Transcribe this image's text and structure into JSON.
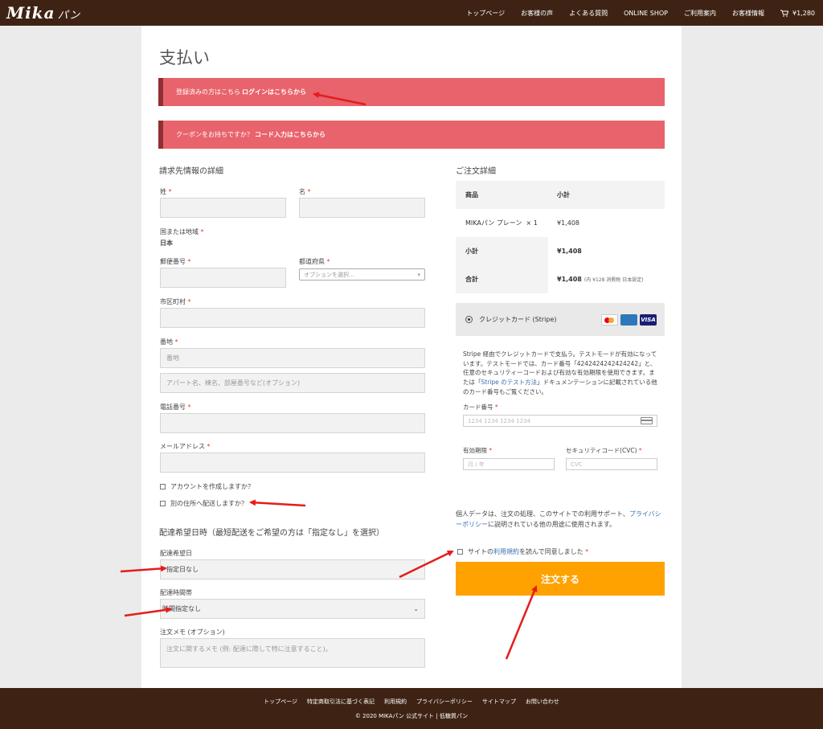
{
  "header": {
    "logo_main": "Mika",
    "logo_sub": "パン",
    "nav": [
      "トップページ",
      "お客様の声",
      "よくある質問",
      "ONLINE SHOP",
      "ご利用案内",
      "お客様情報"
    ],
    "cart_total": "¥1,280"
  },
  "page_title": "支払い",
  "notices": {
    "login_text": "登録済みの方はこちら",
    "login_link": "ログインはこちらから",
    "coupon_text": "クーポンをお持ちですか？",
    "coupon_link": "コード入力はこちらから"
  },
  "billing": {
    "heading": "請求先情報の詳細",
    "last_name": "姓",
    "first_name": "名",
    "country_label": "国または地域",
    "country_value": "日本",
    "postcode": "郵便番号",
    "prefecture": "都道府県",
    "prefecture_placeholder": "オプションを選択...",
    "city": "市区町村",
    "address": "番地",
    "address_placeholder": "番地",
    "address2_placeholder": "アパート名、棟名、部屋番号など(オプション)",
    "phone": "電話番号",
    "email": "メールアドレス",
    "create_account": "アカウントを作成しますか？",
    "ship_different": "別の住所へ配送しますか？"
  },
  "delivery": {
    "heading": "配達希望日時（最短配送をご希望の方は「指定なし」を選択）",
    "date_label": "配達希望日",
    "date_value": "指定日なし",
    "time_label": "配達時間帯",
    "time_value": "時間指定なし",
    "memo_label": "注文メモ (オプション)",
    "memo_placeholder": "注文に関するメモ (例: 配達に際して特に注意すること)。"
  },
  "order": {
    "heading": "ご注文詳細",
    "col_product": "商品",
    "col_subtotal": "小計",
    "item_name": "MIKAパン プレーン",
    "item_qty": "× 1",
    "item_price": "¥1,408",
    "subtotal_label": "小計",
    "subtotal_value": "¥1,408",
    "total_label": "合計",
    "total_value": "¥1,408",
    "total_tax": "(内 ¥128 消費税 日本設定)"
  },
  "payment": {
    "method": "クレジットカード (Stripe)",
    "desc_1": "Stripe 経由でクレジットカードで支払う。テストモードが有効になっています。テストモードでは、カード番号「4242424242424242」と、任意のセキュリティーコードおよび有効な有効期限を使用できます。または「",
    "desc_link": "Stripe のテスト方法",
    "desc_2": "」ドキュメンテーションに記載されている他のカード番号もご覧ください。",
    "card_number_label": "カード番号",
    "card_number_placeholder": "1234 1234 1234 1234",
    "expiry_label": "有効期限",
    "expiry_placeholder": "月 / 年",
    "cvc_label": "セキュリティコード(CVC)",
    "cvc_placeholder": "CVC",
    "visa": "VISA"
  },
  "privacy": {
    "text_1": "個人データは、注文の処理、このサイトでの利用サポート、",
    "link": "プライバシーポリシー",
    "text_2": "に説明されている他の用途に使用されます。"
  },
  "terms": {
    "text_1": "サイトの",
    "link": "利用規約",
    "text_2": "を読んで同意しました"
  },
  "place_order": "注文する",
  "footer": {
    "links": [
      "トップページ",
      "特定商取引法に基づく表記",
      "利用規約",
      "プライバシーポリシー",
      "サイトマップ",
      "お問い合わせ"
    ],
    "copyright": "© 2020 MIKAパン 公式サイト | 低糖質パン"
  }
}
